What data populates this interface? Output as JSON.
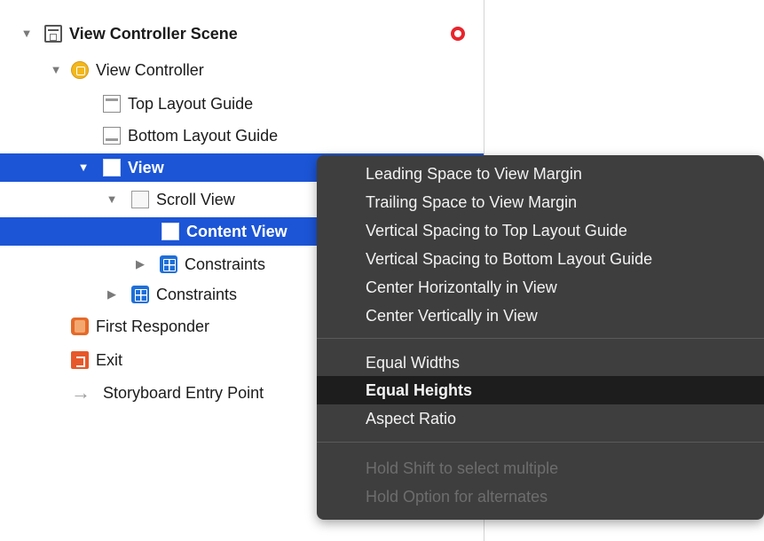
{
  "outline": {
    "scene_label": "View Controller Scene",
    "view_controller_label": "View Controller",
    "top_layout_guide_label": "Top Layout Guide",
    "bottom_layout_guide_label": "Bottom Layout Guide",
    "view_label": "View",
    "scroll_view_label": "Scroll View",
    "content_view_label": "Content View",
    "constraints_inner_label": "Constraints",
    "constraints_outer_label": "Constraints",
    "first_responder_label": "First Responder",
    "exit_label": "Exit",
    "entry_point_label": "Storyboard Entry Point",
    "disclosure_expanded": "▼",
    "disclosure_collapsed": "▶",
    "arrow_glyph": "→"
  },
  "menu": {
    "items_group1": [
      "Leading Space to View Margin",
      "Trailing Space to View Margin",
      "Vertical Spacing to Top Layout Guide",
      "Vertical Spacing to Bottom Layout Guide",
      "Center Horizontally in View",
      "Center Vertically in View"
    ],
    "items_group2": [
      "Equal Widths",
      "Equal Heights",
      "Aspect Ratio"
    ],
    "highlighted_item": "Equal Heights",
    "hints": [
      "Hold Shift to select multiple",
      "Hold Option for alternates"
    ]
  },
  "colors": {
    "selection": "#1c55d6",
    "menu_background": "#3e3e3e",
    "menu_highlight": "#1d1d1d",
    "warning": "#e8242c"
  }
}
